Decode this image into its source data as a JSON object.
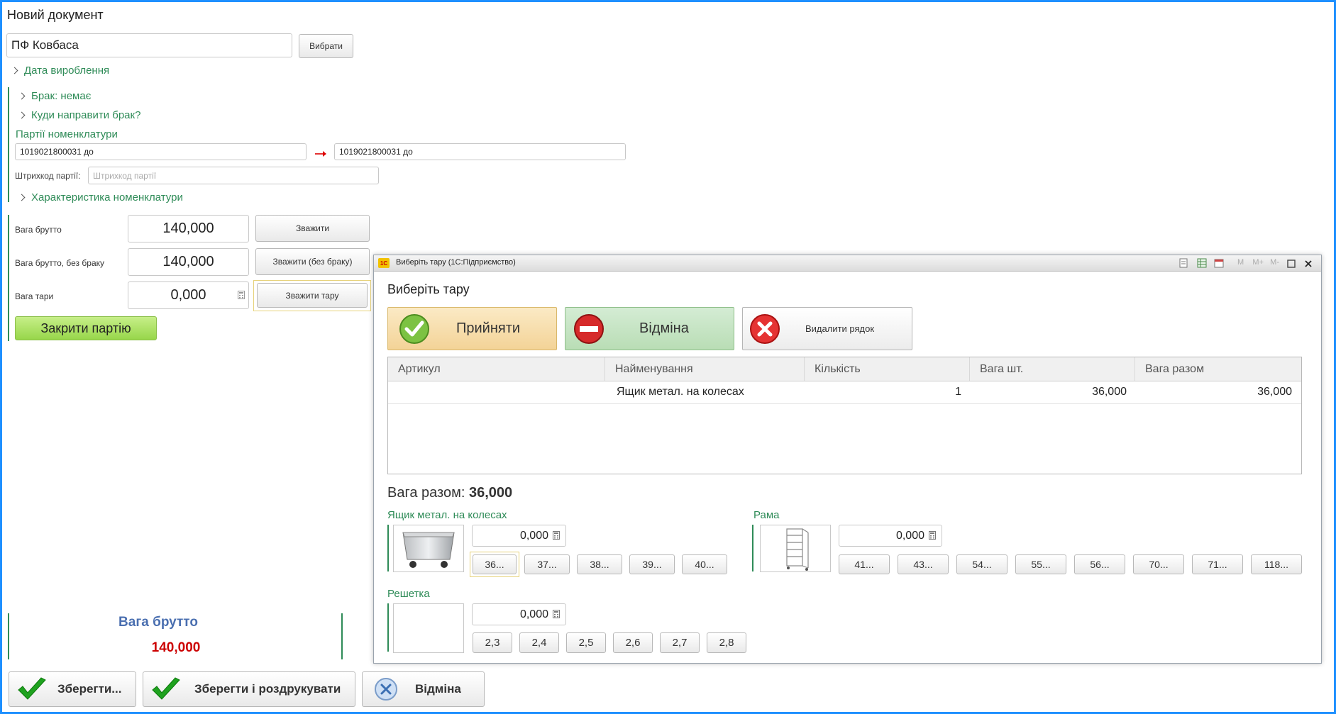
{
  "page": {
    "title": "Новий документ",
    "product_value": "ПФ Ковбаса",
    "select_button": "Вибрати",
    "date_section": "Дата вироблення",
    "defect_section": "Брак: немає",
    "defect_direction_section": "Куди направити брак?",
    "batches_label": "Партії номенклатури",
    "batch_from": "1019021800031 до",
    "batch_to": "1019021800031 до",
    "barcode_label": "Штрихкод партії:",
    "barcode_placeholder": "Штрихкод партії",
    "characteristic_section": "Характеристика номенклатури",
    "gross_label": "Вага брутто",
    "gross_value": "140,000",
    "weigh_button": "Зважити",
    "gross_no_defect_label": "Вага брутто, без браку",
    "gross_no_defect_value": "140,000",
    "weigh_no_defect_button": "Зважити (без браку)",
    "tare_label": "Вага тари",
    "tare_value": "0,000",
    "weigh_tare_button": "Зважити тару",
    "close_batch_button": "Закрити партію",
    "summary_label": "Вага брутто",
    "summary_value": "140,000",
    "save_button": "Зберегти...",
    "save_print_button": "Зберегти і роздрукувати",
    "cancel_button": "Відміна"
  },
  "dialog": {
    "window_title": "Виберіть тару  (1С:Підприємство)",
    "app_badge": "1С",
    "title_tools": [
      "M",
      "M+",
      "M-"
    ],
    "heading": "Виберіть тару",
    "accept_button": "Прийняти",
    "cancel_button": "Відміна",
    "delete_row_button": "Видалити рядок",
    "columns": [
      "Артикул",
      "Найменування",
      "Кількість",
      "Вага шт.",
      "Вага разом"
    ],
    "rows": [
      {
        "article": "",
        "name": "Ящик метал. на колесах",
        "qty": "1",
        "unit_weight": "36,000",
        "total": "36,000"
      }
    ],
    "total_label": "Вага разом:",
    "total_value": "36,000",
    "groups": [
      {
        "title": "Ящик метал. на колесах",
        "value": "0,000",
        "buttons": [
          "36...",
          "37...",
          "38...",
          "39...",
          "40..."
        ]
      },
      {
        "title": "Рама",
        "value": "0,000",
        "buttons": [
          "41...",
          "43...",
          "54...",
          "55...",
          "56...",
          "70...",
          "71...",
          "118..."
        ]
      },
      {
        "title": "Решетка",
        "value": "0,000",
        "buttons": [
          "2,3",
          "2,4",
          "2,5",
          "2,6",
          "2,7",
          "2,8"
        ]
      }
    ]
  },
  "colors": {
    "accent_green": "#2e8b57",
    "frame_blue": "#1e90ff",
    "summary_blue": "#4a6fb0",
    "summary_red": "#cc0000"
  }
}
